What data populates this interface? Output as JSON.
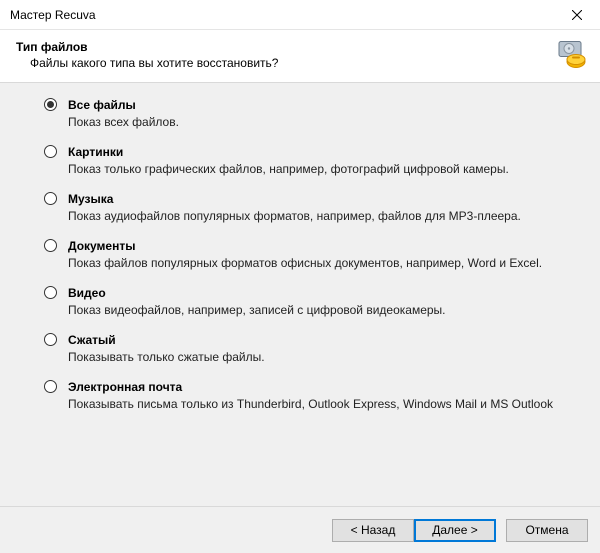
{
  "window": {
    "title": "Мастер Recuva"
  },
  "header": {
    "title": "Тип файлов",
    "subtitle": "Файлы какого типа вы хотите восстановить?"
  },
  "options": [
    {
      "label": "Все файлы",
      "desc": "Показ всех файлов.",
      "selected": true
    },
    {
      "label": "Картинки",
      "desc": "Показ только графических файлов, например, фотографий цифровой камеры.",
      "selected": false
    },
    {
      "label": "Музыка",
      "desc": "Показ аудиофайлов популярных форматов, например, файлов для MP3-плеера.",
      "selected": false
    },
    {
      "label": "Документы",
      "desc": "Показ файлов популярных форматов офисных документов, например, Word и Excel.",
      "selected": false
    },
    {
      "label": "Видео",
      "desc": "Показ видеофайлов, например, записей с цифровой видеокамеры.",
      "selected": false
    },
    {
      "label": "Сжатый",
      "desc": "Показывать только сжатые файлы.",
      "selected": false
    },
    {
      "label": "Электронная почта",
      "desc": "Показывать письма только из Thunderbird, Outlook Express, Windows Mail и MS Outlook",
      "selected": false
    }
  ],
  "footer": {
    "back": "< Назад",
    "next": "Далее >",
    "cancel": "Отмена"
  }
}
